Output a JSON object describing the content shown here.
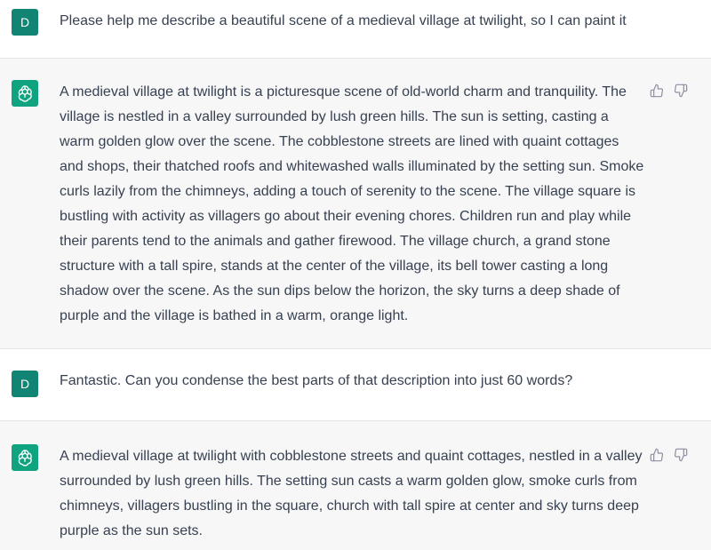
{
  "conversation": {
    "messages": [
      {
        "role": "user",
        "avatar_letter": "D",
        "text": "Please help me describe a beautiful scene of a medieval village at twilight, so I can paint it"
      },
      {
        "role": "assistant",
        "text": "A medieval village at twilight is a picturesque scene of old-world charm and tranquility. The village is nestled in a valley surrounded by lush green hills. The sun is setting, casting a warm golden glow over the scene. The cobblestone streets are lined with quaint cottages and shops, their thatched roofs and whitewashed walls illuminated by the setting sun. Smoke curls lazily from the chimneys, adding a touch of serenity to the scene. The village square is bustling with activity as villagers go about their evening chores. Children run and play while their parents tend to the animals and gather firewood. The village church, a grand stone structure with a tall spire, stands at the center of the village, its bell tower casting a long shadow over the scene. As the sun dips below the horizon, the sky turns a deep shade of purple and the village is bathed in a warm, orange light."
      },
      {
        "role": "user",
        "avatar_letter": "D",
        "text": "Fantastic. Can you condense the best parts of that description into just 60 words?"
      },
      {
        "role": "assistant",
        "text": "A medieval village at twilight with cobblestone streets and quaint cottages, nestled in a valley surrounded by lush green hills. The setting sun casts a warm golden glow, smoke curls from chimneys, villagers bustling in the square, church with tall spire at center and sky turns deep purple as the sun sets."
      }
    ]
  },
  "icons": {
    "assistant_avatar": "openai-logo-icon",
    "like": "thumbs-up-icon",
    "dislike": "thumbs-down-icon"
  },
  "colors": {
    "user_avatar_bg": "#128474",
    "assistant_avatar_bg": "#10a37f",
    "assistant_row_bg": "#f7f7f8",
    "text": "#374151",
    "icon": "#8e8ea0"
  }
}
